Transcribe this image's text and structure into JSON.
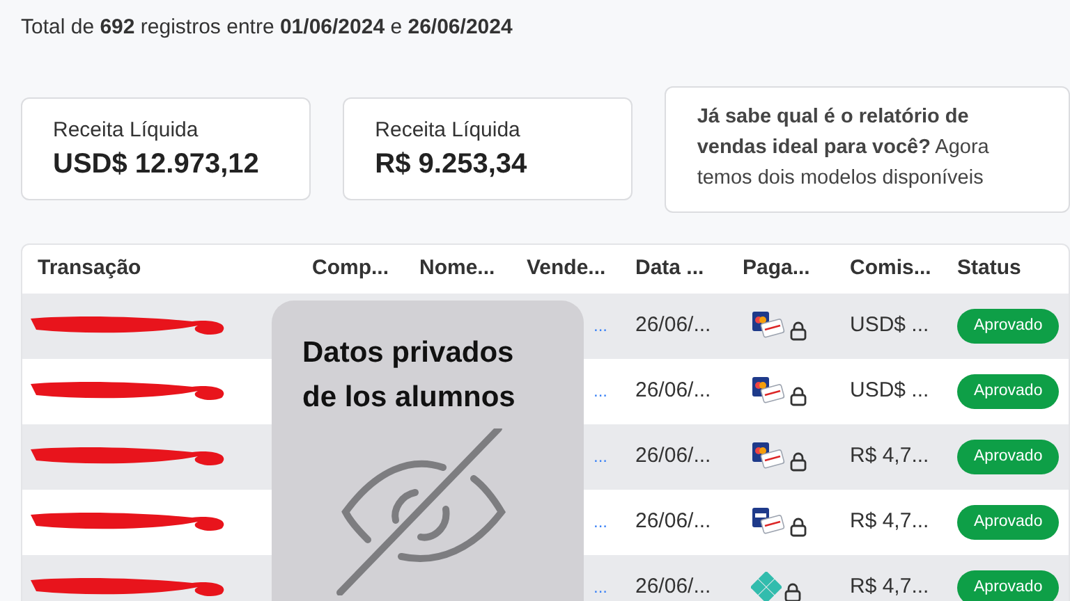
{
  "summary": "Total de **692** registros entre **01/06/2024** e **26/06/2024**",
  "cards": [
    {
      "label": "Receita Líquida",
      "value": "USD$ 12.973,12"
    },
    {
      "label": "Receita Líquida",
      "value": "R$ 9.253,34"
    }
  ],
  "promo": "**Já sabe qual é o relatório de vendas ideal para você?** Agora temos dois modelos disponíveis",
  "table": {
    "columns": [
      "Transação",
      "Comp...",
      "Nome...",
      "Vende...",
      "Data ...",
      "Paga...",
      "Comis...",
      "Status"
    ],
    "rows": [
      {
        "seller": "...",
        "date": "26/06/...",
        "payment": {
          "kind": "mastercard"
        },
        "commission": "USD$ ...",
        "status": "Aprovado"
      },
      {
        "seller": "...",
        "date": "26/06/...",
        "payment": {
          "kind": "mastercard"
        },
        "commission": "USD$ ...",
        "status": "Aprovado"
      },
      {
        "seller": "...",
        "date": "26/06/...",
        "payment": {
          "kind": "mastercard"
        },
        "commission": "R$ 4,7...",
        "status": "Aprovado"
      },
      {
        "seller": "...",
        "date": "26/06/...",
        "payment": {
          "kind": "visa"
        },
        "commission": "R$ 4,7...",
        "status": "Aprovado"
      },
      {
        "seller": "...",
        "date": "26/06/...",
        "payment": {
          "kind": "pix"
        },
        "commission": "R$ 4,7...",
        "status": "Aprovado"
      }
    ]
  },
  "overlay": {
    "text": "Datos privados de los alumnos"
  }
}
